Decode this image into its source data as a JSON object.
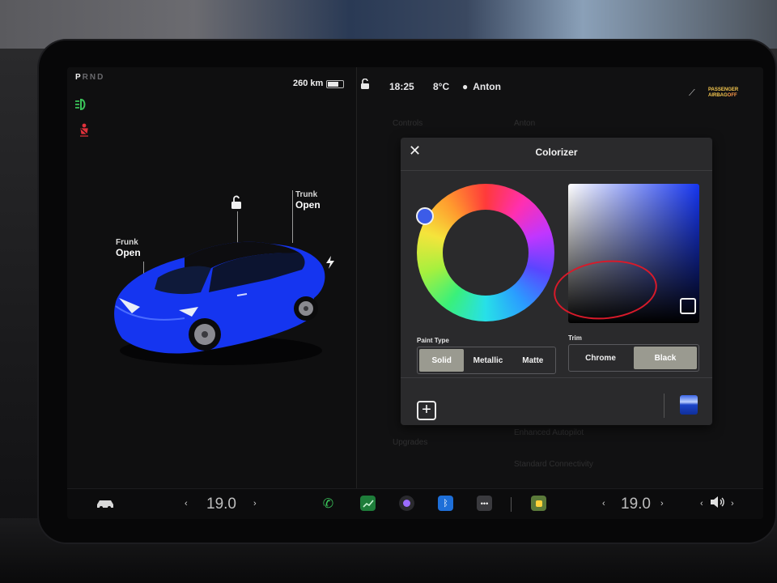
{
  "left_panel": {
    "gear": {
      "active": "P",
      "others": "RND"
    },
    "range": "260 km",
    "frunk": {
      "label": "Frunk",
      "status": "Open"
    },
    "trunk": {
      "label": "Trunk",
      "status": "Open"
    }
  },
  "status_bar": {
    "time": "18:25",
    "temperature": "8°C",
    "user": "Anton",
    "airbag_line1": "PASSENGER",
    "airbag_line2": "AIRBAG",
    "airbag_state": "OFF"
  },
  "settings_background": {
    "items": [
      "Controls",
      "Upgrades"
    ],
    "right_items": [
      "Anton",
      "Enhanced Autopilot",
      "Standard Connectivity"
    ]
  },
  "dialog": {
    "title": "Colorizer",
    "close_icon": "close-icon",
    "paint_type": {
      "label": "Paint Type",
      "options": [
        "Solid",
        "Metallic",
        "Matte"
      ],
      "selected": "Solid"
    },
    "trim": {
      "label": "Trim",
      "options": [
        "Chrome",
        "Black"
      ],
      "selected": "Black"
    },
    "add_icon": "plus-icon",
    "selected_color": "#1535f0"
  },
  "taskbar": {
    "driver_temp": "19.0",
    "passenger_temp": "19.0",
    "apps": [
      "phone-icon",
      "energy-icon",
      "camera-icon",
      "bluetooth-icon",
      "more-icon",
      "toybox-icon"
    ]
  },
  "colors": {
    "car_blue": "#1535f0",
    "accent_green": "#3bc45a",
    "warning_red": "#e0313b",
    "annotation_red": "#d81a2a"
  }
}
